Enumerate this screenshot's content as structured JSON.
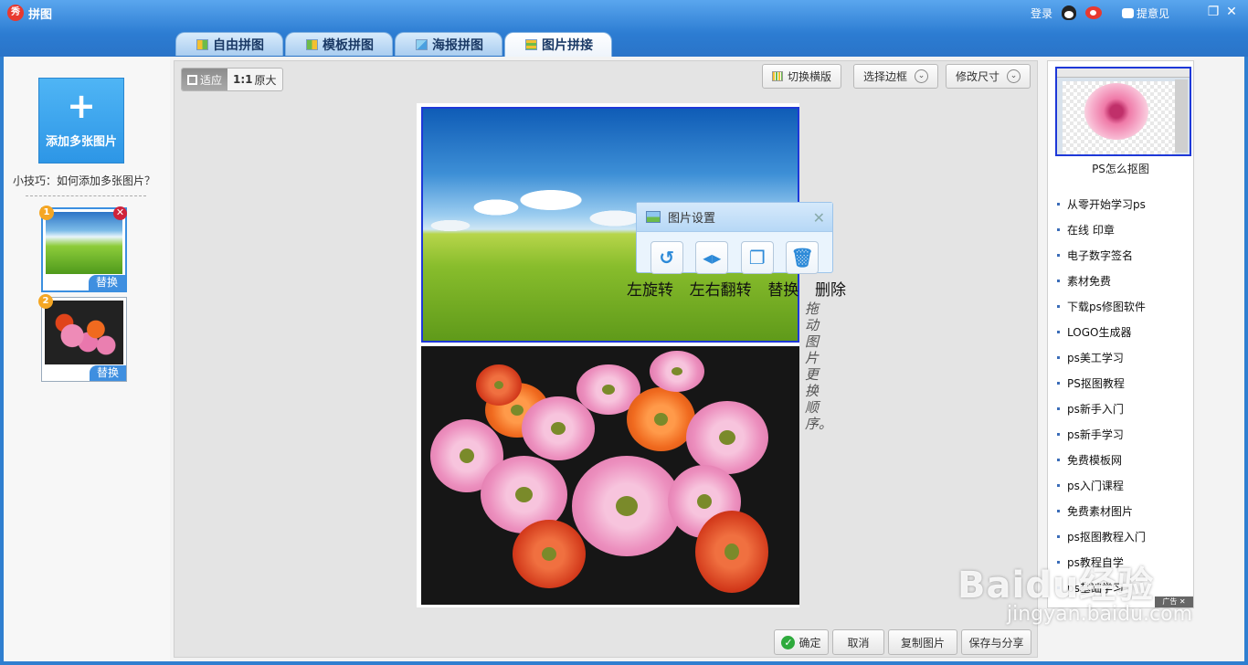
{
  "app": {
    "title": "拼图"
  },
  "topbar": {
    "login": "登录",
    "feedback": "提意见"
  },
  "tabs": [
    {
      "label": "自由拼图"
    },
    {
      "label": "模板拼图"
    },
    {
      "label": "海报拼图"
    },
    {
      "label": "图片拼接",
      "active": true
    }
  ],
  "left": {
    "add_label": "添加多张图片",
    "tip": "小技巧：如何添加多张图片？",
    "thumbnails": [
      {
        "number": "1",
        "replace": "替换"
      },
      {
        "number": "2",
        "replace": "替换"
      }
    ]
  },
  "workspace": {
    "fit_label": "适应",
    "original_prefix": "1:1",
    "original_label": "原大",
    "switch_horizontal": "切换横版",
    "select_border": "选择边框",
    "resize": "修改尺寸",
    "side_note": "拖动图片更换顺序。"
  },
  "popup": {
    "title": "图片设置",
    "actions": [
      "左旋转",
      "左右翻转",
      "替换",
      "删除"
    ]
  },
  "bottom": {
    "confirm": "确定",
    "cancel": "取消",
    "copy": "复制图片",
    "save_share": "保存与分享"
  },
  "right": {
    "ad_caption": "PS怎么抠图",
    "links": [
      "从零开始学习ps",
      "在线 印章",
      "电子数字签名",
      "素材免费",
      "下载ps修图软件",
      "LOGO生成器",
      "ps美工学习",
      "PS抠图教程",
      "ps新手入门",
      "ps新手学习",
      "免费模板网",
      "ps入门课程",
      "免费素材图片",
      "ps抠图教程入门",
      "ps教程自学",
      "ps基础学习"
    ],
    "ad_foot": "广告"
  },
  "watermark": {
    "main": "Baidu经验",
    "sub": "jingyan.baidu.com"
  },
  "colors": {
    "titlebar": "#2c7cd2",
    "accent": "#3b8fe0",
    "selection_border": "#1e38d8"
  }
}
